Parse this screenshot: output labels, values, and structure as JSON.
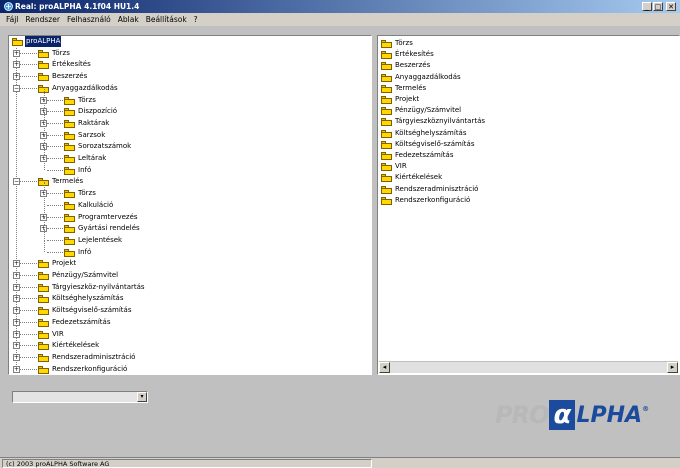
{
  "window": {
    "title": "Real: proALPHA 4.1f04 HU1.4",
    "buttons": {
      "minimize": "_",
      "maximize": "□",
      "close": "✕"
    }
  },
  "menubar": [
    "Fájl",
    "Rendszer",
    "Felhasználó",
    "Ablak",
    "Beállítások",
    "?"
  ],
  "tree": {
    "root": "proALPHA",
    "items": [
      {
        "label": "Törzs",
        "level": 1,
        "expander": "+"
      },
      {
        "label": "Értékesítés",
        "level": 1,
        "expander": "+"
      },
      {
        "label": "Beszerzés",
        "level": 1,
        "expander": "+"
      },
      {
        "label": "Anyaggazdálkodás",
        "level": 1,
        "expander": "−"
      },
      {
        "label": "Törzs",
        "level": 2,
        "expander": "+"
      },
      {
        "label": "Diszpozíció",
        "level": 2,
        "expander": "+"
      },
      {
        "label": "Raktárak",
        "level": 2,
        "expander": "+"
      },
      {
        "label": "Sarzsok",
        "level": 2,
        "expander": "+"
      },
      {
        "label": "Sorozatszámok",
        "level": 2,
        "expander": "+"
      },
      {
        "label": "Leltárak",
        "level": 2,
        "expander": "+"
      },
      {
        "label": "Infó",
        "level": 2,
        "expander": ""
      },
      {
        "label": "Termelés",
        "level": 1,
        "expander": "−"
      },
      {
        "label": "Törzs",
        "level": 2,
        "expander": "+"
      },
      {
        "label": "Kalkuláció",
        "level": 2,
        "expander": ""
      },
      {
        "label": "Programtervezés",
        "level": 2,
        "expander": "+"
      },
      {
        "label": "Gyártási rendelés",
        "level": 2,
        "expander": "+"
      },
      {
        "label": "Lejelentések",
        "level": 2,
        "expander": ""
      },
      {
        "label": "Infó",
        "level": 2,
        "expander": ""
      },
      {
        "label": "Projekt",
        "level": 1,
        "expander": "+"
      },
      {
        "label": "Pénzügy/Számvitel",
        "level": 1,
        "expander": "+"
      },
      {
        "label": "Tárgyieszköz-nyilvántartás",
        "level": 1,
        "expander": "+"
      },
      {
        "label": "Költséghelyszámítás",
        "level": 1,
        "expander": "+"
      },
      {
        "label": "Költségviselő-számítás",
        "level": 1,
        "expander": "+"
      },
      {
        "label": "Fedezetszámítás",
        "level": 1,
        "expander": "+"
      },
      {
        "label": "VIR",
        "level": 1,
        "expander": "+"
      },
      {
        "label": "Kiértékelések",
        "level": 1,
        "expander": "+"
      },
      {
        "label": "Rendszeradminisztráció",
        "level": 1,
        "expander": "+"
      },
      {
        "label": "Rendszerkonfiguráció",
        "level": 1,
        "expander": "+"
      }
    ]
  },
  "list": {
    "items": [
      "Törzs",
      "Értékesítés",
      "Beszerzés",
      "Anyaggazdálkodás",
      "Termelés",
      "Projekt",
      "Pénzügy/Számvitel",
      "Tárgyieszköznyilvántartás",
      "Költséghelyszámítás",
      "Költségviselő-számítás",
      "Fedezetszámítás",
      "VIR",
      "Kiértékelések",
      "Rendszeradminisztráció",
      "Rendszerkonfiguráció"
    ],
    "scroll_left": "◂",
    "scroll_right": "▸"
  },
  "combo": {
    "value": "",
    "arrow": "▾"
  },
  "logo": {
    "pro": "PRO",
    "alpha": "α",
    "lpha": "LPHA",
    "reg": "®"
  },
  "status": {
    "text": "(c) 2003 proALPHA Software AG"
  },
  "colors": {
    "folder": "#ffd800",
    "selection": "#0a246a",
    "logo_blue": "#1c4a9c",
    "titlebar": "#0a246a"
  }
}
